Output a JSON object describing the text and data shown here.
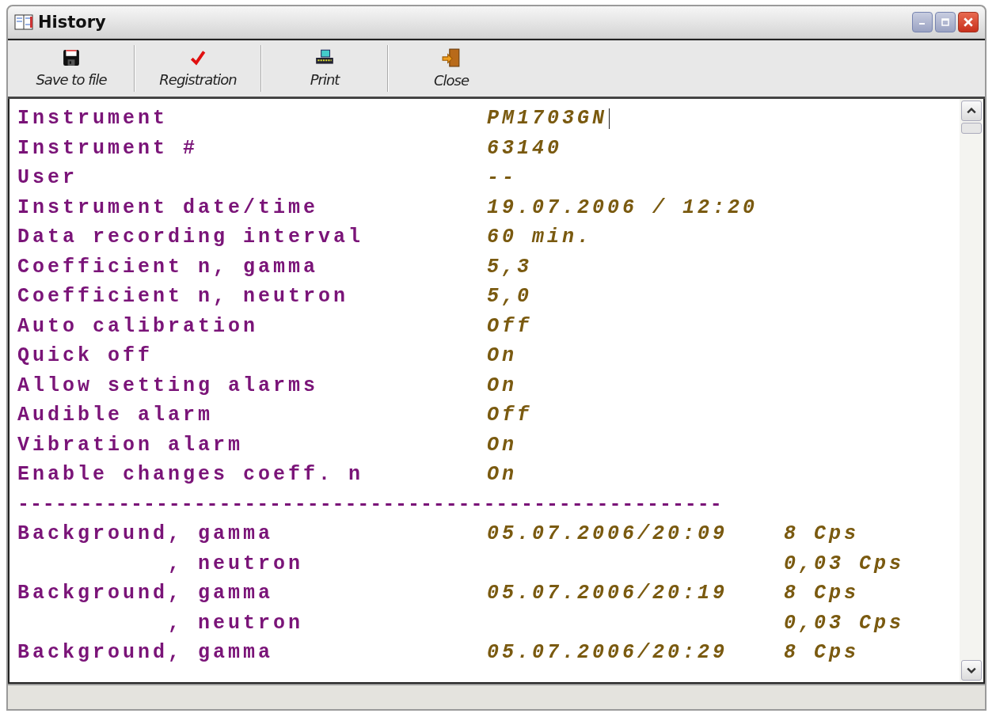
{
  "window": {
    "title": "History"
  },
  "toolbar": [
    {
      "kind": "save",
      "label": "Save to file"
    },
    {
      "kind": "check",
      "label": "Registration"
    },
    {
      "kind": "print",
      "label": "Print"
    },
    {
      "kind": "exit",
      "label": "Close"
    }
  ],
  "rows": [
    {
      "kind": "setting",
      "label": "Instrument",
      "value": "PM1703GN"
    },
    {
      "kind": "setting",
      "label": "Instrument #",
      "value": "63140"
    },
    {
      "kind": "setting",
      "label": "User",
      "value": "--"
    },
    {
      "kind": "setting",
      "label": "Instrument date/time",
      "value": "19.07.2006 / 12:20"
    },
    {
      "kind": "setting",
      "label": "Data recording interval",
      "value": "60 min."
    },
    {
      "kind": "setting",
      "label": "Coefficient n, gamma",
      "value": "5,3"
    },
    {
      "kind": "setting",
      "label": "Coefficient n, neutron",
      "value": "5,0"
    },
    {
      "kind": "setting",
      "label": "Auto calibration",
      "value": "Off"
    },
    {
      "kind": "setting",
      "label": "Quick off",
      "value": "On"
    },
    {
      "kind": "setting",
      "label": "Allow setting alarms",
      "value": "On"
    },
    {
      "kind": "setting",
      "label": "Audible alarm",
      "value": "Off"
    },
    {
      "kind": "setting",
      "label": "Vibration alarm",
      "value": "On"
    },
    {
      "kind": "setting",
      "label": "Enable changes coeff. n",
      "value": "On"
    },
    {
      "kind": "separator",
      "label": "--------------------------------------------------------"
    },
    {
      "kind": "reading",
      "label": "Background, gamma",
      "value": "05.07.2006/20:09",
      "reading": "8 Cps"
    },
    {
      "kind": "reading",
      "label": "          , neutron",
      "reading": "0,03 Cps"
    },
    {
      "kind": "reading",
      "label": "Background, gamma",
      "value": "05.07.2006/20:19",
      "reading": "8 Cps"
    },
    {
      "kind": "reading",
      "label": "          , neutron",
      "reading": "0,03 Cps"
    },
    {
      "kind": "reading",
      "label": "Background, gamma",
      "value": "05.07.2006/20:29",
      "reading": "8 Cps"
    }
  ]
}
